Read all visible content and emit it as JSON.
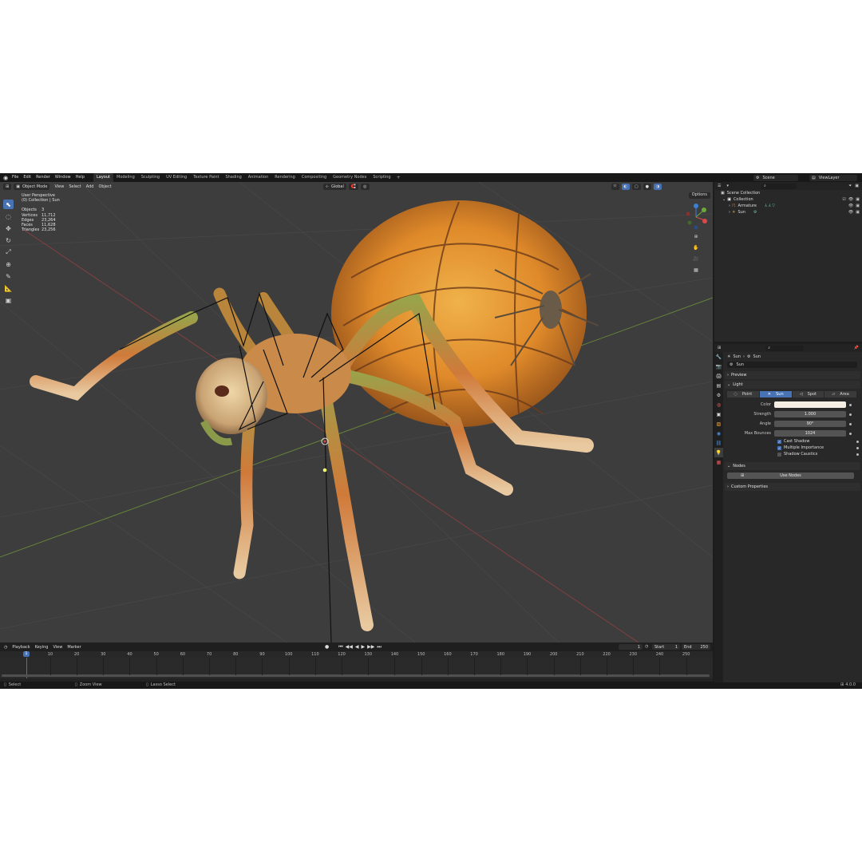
{
  "menu": {
    "items": [
      "File",
      "Edit",
      "Render",
      "Window",
      "Help"
    ],
    "workspaces": [
      "Layout",
      "Modeling",
      "Sculpting",
      "UV Editing",
      "Texture Paint",
      "Shading",
      "Animation",
      "Rendering",
      "Compositing",
      "Geometry Nodes",
      "Scripting"
    ],
    "active_workspace": "Layout",
    "add_tab": "+",
    "scene": "Scene",
    "view_layer": "ViewLayer"
  },
  "viewport": {
    "mode": "Object Mode",
    "menus": [
      "View",
      "Select",
      "Add",
      "Object"
    ],
    "orientation": "Global",
    "options": "Options",
    "view_name": "User Perspective",
    "collection_info": "(0) Collection | Sun",
    "stats": [
      {
        "label": "Objects",
        "value": "3"
      },
      {
        "label": "Vertices",
        "value": "11,712"
      },
      {
        "label": "Edges",
        "value": "23,264"
      },
      {
        "label": "Faces",
        "value": "11,628"
      },
      {
        "label": "Triangles",
        "value": "23,256"
      }
    ]
  },
  "timeline": {
    "menus": [
      "Playback",
      "Keying",
      "View",
      "Marker"
    ],
    "current_frame": "1",
    "start_label": "Start",
    "start": "1",
    "end_label": "End",
    "end": "250",
    "ticks": [
      "10",
      "20",
      "30",
      "40",
      "50",
      "60",
      "70",
      "80",
      "90",
      "100",
      "110",
      "120",
      "130",
      "140",
      "150",
      "160",
      "170",
      "180",
      "190",
      "200",
      "210",
      "220",
      "230",
      "240",
      "250"
    ]
  },
  "status": {
    "select": "Select",
    "zoom": "Zoom View",
    "lasso": "Lasso Select",
    "version": "4.0.0"
  },
  "outliner": {
    "search_placeholder": "",
    "scene_collection": "Scene Collection",
    "collection": "Collection",
    "armature": "Armature",
    "sun": "Sun"
  },
  "properties": {
    "breadcrumb_a": "Sun",
    "breadcrumb_b": "Sun",
    "name": "Sun",
    "preview_label": "Preview",
    "light_label": "Light",
    "light_types": [
      "Point",
      "Sun",
      "Spot",
      "Area"
    ],
    "active_light_type": "Sun",
    "color_label": "Color",
    "color_value": "#f4efe2",
    "strength_label": "Strength",
    "strength": "1.000",
    "angle_label": "Angle",
    "angle": "90°",
    "max_bounces_label": "Max Bounces",
    "max_bounces": "1024",
    "cast_shadow": "Cast Shadow",
    "multiple_importance": "Multiple Importance",
    "shadow_caustics": "Shadow Caustics",
    "nodes_label": "Nodes",
    "use_nodes": "Use Nodes",
    "custom_properties": "Custom Properties"
  },
  "colors": {
    "accent": "#4772b3",
    "viewport_bg": "#3d3d3d",
    "panel_bg": "#282828"
  }
}
